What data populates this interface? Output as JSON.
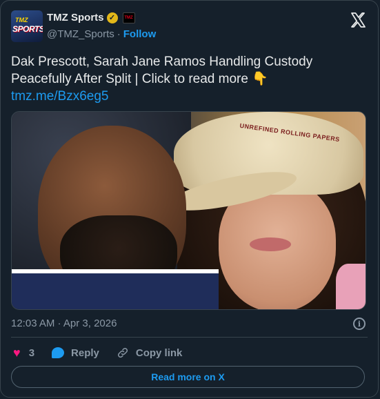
{
  "account": {
    "display_name": "TMZ Sports",
    "handle": "@TMZ_Sports",
    "separator": "·",
    "follow_label": "Follow",
    "avatar_text_top": "TMZ",
    "avatar_text_bottom": "SPORTS",
    "verified_icon": "gold-check",
    "affiliate_badge_text": "TMZ"
  },
  "tweet": {
    "text": "Dak Prescott, Sarah Jane Ramos Handling Custody Peacefully After Split  | Click to read more 👇",
    "link": "tmz.me/Bzx6eg5",
    "image_overlay_text": "UNREFINED ROLLING PAPERS"
  },
  "meta": {
    "timestamp": "12:03 AM · Apr 3, 2026",
    "info_icon_glyph": "i"
  },
  "actions": {
    "like_count": "3",
    "reply_label": "Reply",
    "copy_link_label": "Copy link",
    "read_more_label": "Read more on X"
  },
  "colors": {
    "background": "#15202b",
    "accent": "#1d9bf0",
    "heart": "#f91880",
    "muted": "#8b98a5",
    "verified_gold": "#e2b719"
  }
}
